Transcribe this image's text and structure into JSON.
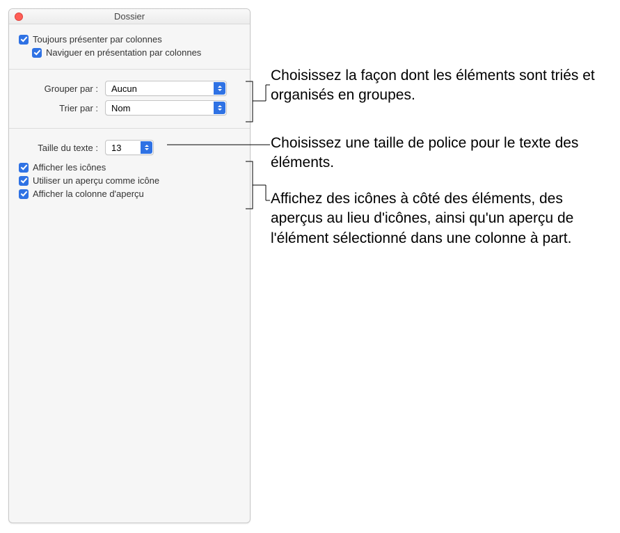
{
  "window": {
    "title": "Dossier"
  },
  "section1": {
    "always_columns": "Toujours présenter par colonnes",
    "browse_columns": "Naviguer en présentation par colonnes"
  },
  "section2": {
    "group_by_label": "Grouper par :",
    "group_by_value": "Aucun",
    "sort_by_label": "Trier par :",
    "sort_by_value": "Nom"
  },
  "section3": {
    "text_size_label": "Taille du texte :",
    "text_size_value": "13",
    "show_icons": "Afficher les icônes",
    "use_preview_icon": "Utiliser un aperçu comme icône",
    "show_preview_column": "Afficher la colonne d'aperçu"
  },
  "annotations": {
    "a1": "Choisissez la façon dont les éléments sont triés et organisés en groupes.",
    "a2": "Choisissez une taille de police pour le texte des éléments.",
    "a3": "Affichez des icônes à côté des éléments, des aperçus au lieu d'icônes, ainsi qu'un aperçu de l'élément sélectionné dans une colonne à part."
  }
}
